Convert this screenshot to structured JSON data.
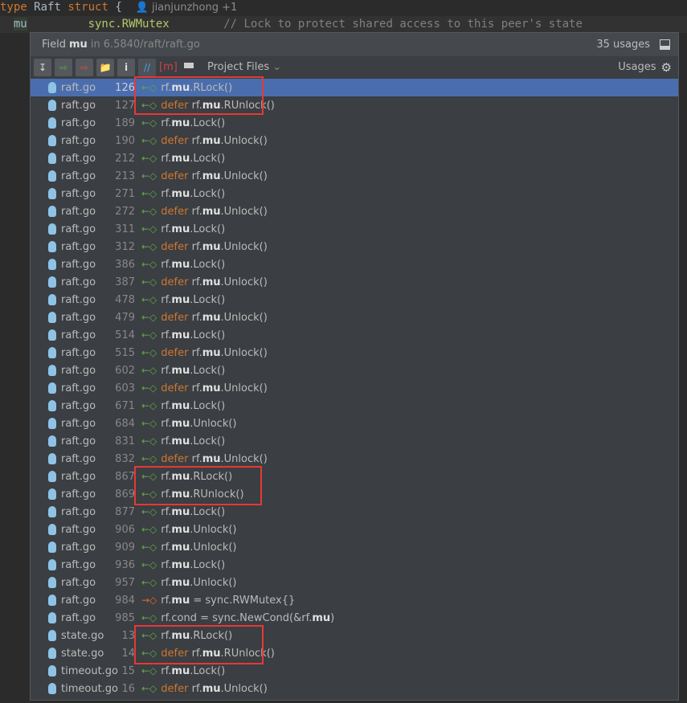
{
  "editor": {
    "line1": {
      "kw1": "type",
      "name": "Raft",
      "kw2": "struct",
      "brace": "{",
      "author": "jianjunzhong +1"
    },
    "line2": {
      "field": "mu",
      "type_pkg": "sync.",
      "type_name": "RWMutex",
      "comment": "// Lock to protect shared access to this peer's state"
    }
  },
  "popup": {
    "header": {
      "prefix": "Field",
      "name": "mu",
      "in": "in",
      "path": "6.5840/raft/raft.go",
      "count": "35 usages"
    },
    "toolbar": {
      "scope": "Project Files",
      "usages_label": "Usages"
    },
    "colors": {
      "selected": "#4a6dad",
      "highlight_box": "#e53935"
    },
    "rows": [
      {
        "file": "raft.go",
        "line": "126",
        "defer": "",
        "before": "rf.",
        "mu": "mu",
        "after": ".RLock()",
        "access": "read",
        "selected": true
      },
      {
        "file": "raft.go",
        "line": "127",
        "defer": "defer ",
        "before": "rf.",
        "mu": "mu",
        "after": ".RUnlock()",
        "access": "read"
      },
      {
        "file": "raft.go",
        "line": "189",
        "defer": "",
        "before": "rf.",
        "mu": "mu",
        "after": ".Lock()",
        "access": "read"
      },
      {
        "file": "raft.go",
        "line": "190",
        "defer": "defer ",
        "before": "rf.",
        "mu": "mu",
        "after": ".Unlock()",
        "access": "read"
      },
      {
        "file": "raft.go",
        "line": "212",
        "defer": "",
        "before": "rf.",
        "mu": "mu",
        "after": ".Lock()",
        "access": "read"
      },
      {
        "file": "raft.go",
        "line": "213",
        "defer": "defer ",
        "before": "rf.",
        "mu": "mu",
        "after": ".Unlock()",
        "access": "read"
      },
      {
        "file": "raft.go",
        "line": "271",
        "defer": "",
        "before": "rf.",
        "mu": "mu",
        "after": ".Lock()",
        "access": "read"
      },
      {
        "file": "raft.go",
        "line": "272",
        "defer": "defer ",
        "before": "rf.",
        "mu": "mu",
        "after": ".Unlock()",
        "access": "read"
      },
      {
        "file": "raft.go",
        "line": "311",
        "defer": "",
        "before": "rf.",
        "mu": "mu",
        "after": ".Lock()",
        "access": "read"
      },
      {
        "file": "raft.go",
        "line": "312",
        "defer": "defer ",
        "before": "rf.",
        "mu": "mu",
        "after": ".Unlock()",
        "access": "read"
      },
      {
        "file": "raft.go",
        "line": "386",
        "defer": "",
        "before": "rf.",
        "mu": "mu",
        "after": ".Lock()",
        "access": "read"
      },
      {
        "file": "raft.go",
        "line": "387",
        "defer": "defer ",
        "before": "rf.",
        "mu": "mu",
        "after": ".Unlock()",
        "access": "read"
      },
      {
        "file": "raft.go",
        "line": "478",
        "defer": "",
        "before": "rf.",
        "mu": "mu",
        "after": ".Lock()",
        "access": "read"
      },
      {
        "file": "raft.go",
        "line": "479",
        "defer": "defer ",
        "before": "rf.",
        "mu": "mu",
        "after": ".Unlock()",
        "access": "read"
      },
      {
        "file": "raft.go",
        "line": "514",
        "defer": "",
        "before": "rf.",
        "mu": "mu",
        "after": ".Lock()",
        "access": "read"
      },
      {
        "file": "raft.go",
        "line": "515",
        "defer": "defer ",
        "before": "rf.",
        "mu": "mu",
        "after": ".Unlock()",
        "access": "read"
      },
      {
        "file": "raft.go",
        "line": "602",
        "defer": "",
        "before": "rf.",
        "mu": "mu",
        "after": ".Lock()",
        "access": "read"
      },
      {
        "file": "raft.go",
        "line": "603",
        "defer": "defer ",
        "before": "rf.",
        "mu": "mu",
        "after": ".Unlock()",
        "access": "read"
      },
      {
        "file": "raft.go",
        "line": "671",
        "defer": "",
        "before": "rf.",
        "mu": "mu",
        "after": ".Lock()",
        "access": "read"
      },
      {
        "file": "raft.go",
        "line": "684",
        "defer": "",
        "before": "rf.",
        "mu": "mu",
        "after": ".Unlock()",
        "access": "read"
      },
      {
        "file": "raft.go",
        "line": "831",
        "defer": "",
        "before": "rf.",
        "mu": "mu",
        "after": ".Lock()",
        "access": "read"
      },
      {
        "file": "raft.go",
        "line": "832",
        "defer": "defer ",
        "before": "rf.",
        "mu": "mu",
        "after": ".Unlock()",
        "access": "read"
      },
      {
        "file": "raft.go",
        "line": "867",
        "defer": "",
        "before": "rf.",
        "mu": "mu",
        "after": ".RLock()",
        "access": "read"
      },
      {
        "file": "raft.go",
        "line": "869",
        "defer": "",
        "before": "rf.",
        "mu": "mu",
        "after": ".RUnlock()",
        "access": "read"
      },
      {
        "file": "raft.go",
        "line": "877",
        "defer": "",
        "before": "rf.",
        "mu": "mu",
        "after": ".Lock()",
        "access": "read"
      },
      {
        "file": "raft.go",
        "line": "906",
        "defer": "",
        "before": "rf.",
        "mu": "mu",
        "after": ".Unlock()",
        "access": "read"
      },
      {
        "file": "raft.go",
        "line": "909",
        "defer": "",
        "before": "rf.",
        "mu": "mu",
        "after": ".Unlock()",
        "access": "read"
      },
      {
        "file": "raft.go",
        "line": "936",
        "defer": "",
        "before": "rf.",
        "mu": "mu",
        "after": ".Lock()",
        "access": "read"
      },
      {
        "file": "raft.go",
        "line": "957",
        "defer": "",
        "before": "rf.",
        "mu": "mu",
        "after": ".Unlock()",
        "access": "read"
      },
      {
        "file": "raft.go",
        "line": "984",
        "defer": "",
        "before": "rf.",
        "mu": "mu",
        "after": " = sync.RWMutex{}",
        "access": "write"
      },
      {
        "file": "raft.go",
        "line": "985",
        "defer": "",
        "before": "rf.cond = sync.NewCond(&rf.",
        "mu": "mu",
        "after": ")",
        "access": "read"
      },
      {
        "file": "state.go",
        "line": "13",
        "defer": "",
        "before": "rf.",
        "mu": "mu",
        "after": ".RLock()",
        "access": "read"
      },
      {
        "file": "state.go",
        "line": "14",
        "defer": "defer ",
        "before": "rf.",
        "mu": "mu",
        "after": ".RUnlock()",
        "access": "read"
      },
      {
        "file": "timeout.go",
        "line": "15",
        "defer": "",
        "before": "rf.",
        "mu": "mu",
        "after": ".Lock()",
        "access": "read"
      },
      {
        "file": "timeout.go",
        "line": "16",
        "defer": "defer ",
        "before": "rf.",
        "mu": "mu",
        "after": ".Unlock()",
        "access": "read"
      }
    ]
  }
}
